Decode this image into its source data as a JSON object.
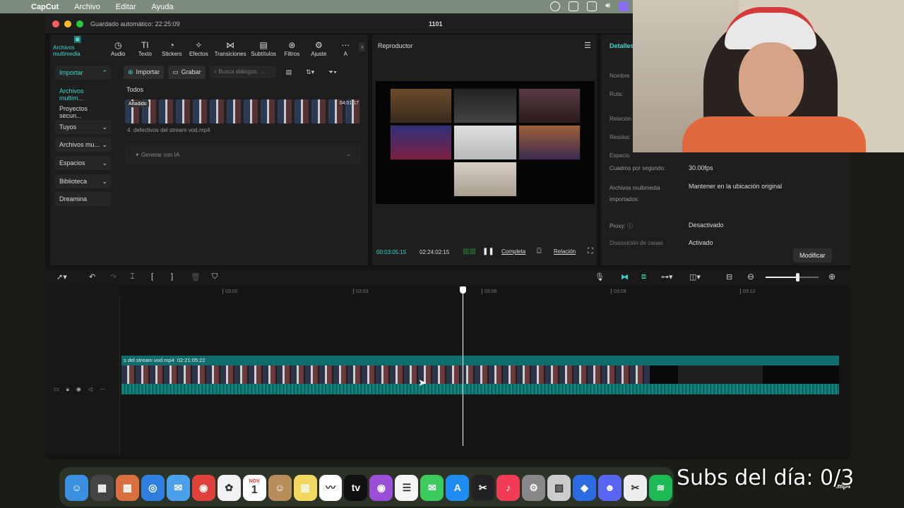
{
  "menubar": {
    "app": "CapCut",
    "items": [
      "Archivo",
      "Editar",
      "Ayuda"
    ]
  },
  "window": {
    "autosave": "Guardado automático: 22:25:09",
    "title": "1101"
  },
  "media_tools": [
    {
      "label": "Archivos multimedia",
      "icon": "media-icon",
      "glyph": "▣",
      "active": true
    },
    {
      "label": "Audio",
      "icon": "audio-icon",
      "glyph": "◷"
    },
    {
      "label": "Texto",
      "icon": "text-icon",
      "glyph": "TI"
    },
    {
      "label": "Stickers",
      "icon": "sticker-icon",
      "glyph": "◔"
    },
    {
      "label": "Efectos",
      "icon": "effects-icon",
      "glyph": "✧"
    },
    {
      "label": "Transiciones",
      "icon": "transitions-icon",
      "glyph": "⋈"
    },
    {
      "label": "Subtítulos",
      "icon": "subtitles-icon",
      "glyph": "▤"
    },
    {
      "label": "Filtros",
      "icon": "filters-icon",
      "glyph": "⊛"
    },
    {
      "label": "Ajuste",
      "icon": "adjust-icon",
      "glyph": "⚙"
    },
    {
      "label": "A",
      "icon": "more-icon",
      "glyph": "⋯"
    }
  ],
  "sidebar": [
    {
      "label": "Importar",
      "active": true,
      "arrow": "^"
    },
    {
      "label": "Archivos multim...",
      "active": true,
      "plain": true
    },
    {
      "label": "Proyectos secun...",
      "plain": true
    },
    {
      "label": "Tuyos",
      "arrow": "v"
    },
    {
      "label": "Archivos mu...",
      "arrow": "v"
    },
    {
      "label": "Espacios",
      "arrow": "v"
    },
    {
      "label": "Biblioteca",
      "arrow": "v"
    },
    {
      "label": "Dreamina"
    }
  ],
  "media": {
    "import_label": "Importar",
    "record_label": "Grabar",
    "search_placeholder": "Busca diálogos, ...",
    "filter_all": "Todos",
    "clip_badge": "Añadido",
    "clip_duration": "04:01:17",
    "clip_name": "4. defectivos del stream vod.mp4",
    "ai_label": "Generar con IA"
  },
  "player": {
    "title": "Reproductor",
    "current_time": "00:03:05:15",
    "total_time": "02:24:02:15",
    "full_label": "Completa",
    "ratio_label": "Relación"
  },
  "details": {
    "title": "Detalles",
    "labels_hidden": [
      "Nombre",
      "Ruta:",
      "Relación",
      "Resoluc",
      "Espacio"
    ],
    "rows": [
      {
        "label": "Cuadros por segundo:",
        "value": "30.00fps"
      },
      {
        "label": "Archivos multimedia importados:",
        "value": "Mantener en la ubicación original"
      },
      {
        "label": "Proxy:",
        "value": "Desactivado"
      },
      {
        "label": "Disposición de capas",
        "value": "Activado"
      }
    ],
    "modify_label": "Modificar"
  },
  "timeline": {
    "ticks": [
      "03:00",
      "03:03",
      "03:06",
      "03:09",
      "03:12"
    ],
    "clip_label": "s del stream vod.mp4",
    "clip_duration": "02:21:05:22",
    "zoom_level": 0.6
  },
  "dock": [
    {
      "icon": "finder-icon",
      "bg": "#3b8fe0",
      "g": "☺"
    },
    {
      "icon": "calculator-icon",
      "bg": "#444",
      "g": "▦"
    },
    {
      "icon": "launchpad-icon",
      "bg": "#d96f3e",
      "g": "▦"
    },
    {
      "icon": "safari-icon",
      "bg": "#2f7fe0",
      "g": "◎"
    },
    {
      "icon": "mail-icon",
      "bg": "#4aa0ea",
      "g": "✉"
    },
    {
      "icon": "chrome-icon",
      "bg": "#e0413a",
      "g": "◉"
    },
    {
      "icon": "photos-icon",
      "bg": "#f2f2f2",
      "g": "✿"
    },
    {
      "icon": "calendar-icon",
      "bg": "#ffffff",
      "g": "1"
    },
    {
      "icon": "contacts-icon",
      "bg": "#b98d5a",
      "g": "☺"
    },
    {
      "icon": "notes-icon",
      "bg": "#f3d860",
      "g": "▤"
    },
    {
      "icon": "freeform-icon",
      "bg": "#ffffff",
      "g": "〰"
    },
    {
      "icon": "tv-icon",
      "bg": "#111",
      "g": "tv"
    },
    {
      "icon": "podcasts-icon",
      "bg": "#9b4fd8",
      "g": "◉"
    },
    {
      "icon": "reminders-icon",
      "bg": "#f5f5f5",
      "g": "☰"
    },
    {
      "icon": "messages-icon",
      "bg": "#3ecb5e",
      "g": "✉"
    },
    {
      "icon": "appstore-icon",
      "bg": "#1e8cf0",
      "g": "A"
    },
    {
      "icon": "capcut-icon",
      "bg": "#222",
      "g": "✂"
    },
    {
      "icon": "music-icon",
      "bg": "#f23c55",
      "g": "♪"
    },
    {
      "icon": "settings-icon",
      "bg": "#888",
      "g": "⚙"
    },
    {
      "icon": "preview-icon",
      "bg": "#ccc",
      "g": "▧"
    },
    {
      "icon": "roblox-icon",
      "bg": "#2d6be0",
      "g": "◆"
    },
    {
      "icon": "discord-icon",
      "bg": "#5865f2",
      "g": "☻"
    },
    {
      "icon": "capcut-dock-icon",
      "bg": "#eee",
      "g": "✂"
    },
    {
      "icon": "spotify-icon",
      "bg": "#1db954",
      "g": "≋"
    }
  ],
  "calendar": {
    "month": "NOV",
    "day": "1"
  },
  "overlay_text": "Subs del día: 0/3",
  "dock_file": ".mp4"
}
